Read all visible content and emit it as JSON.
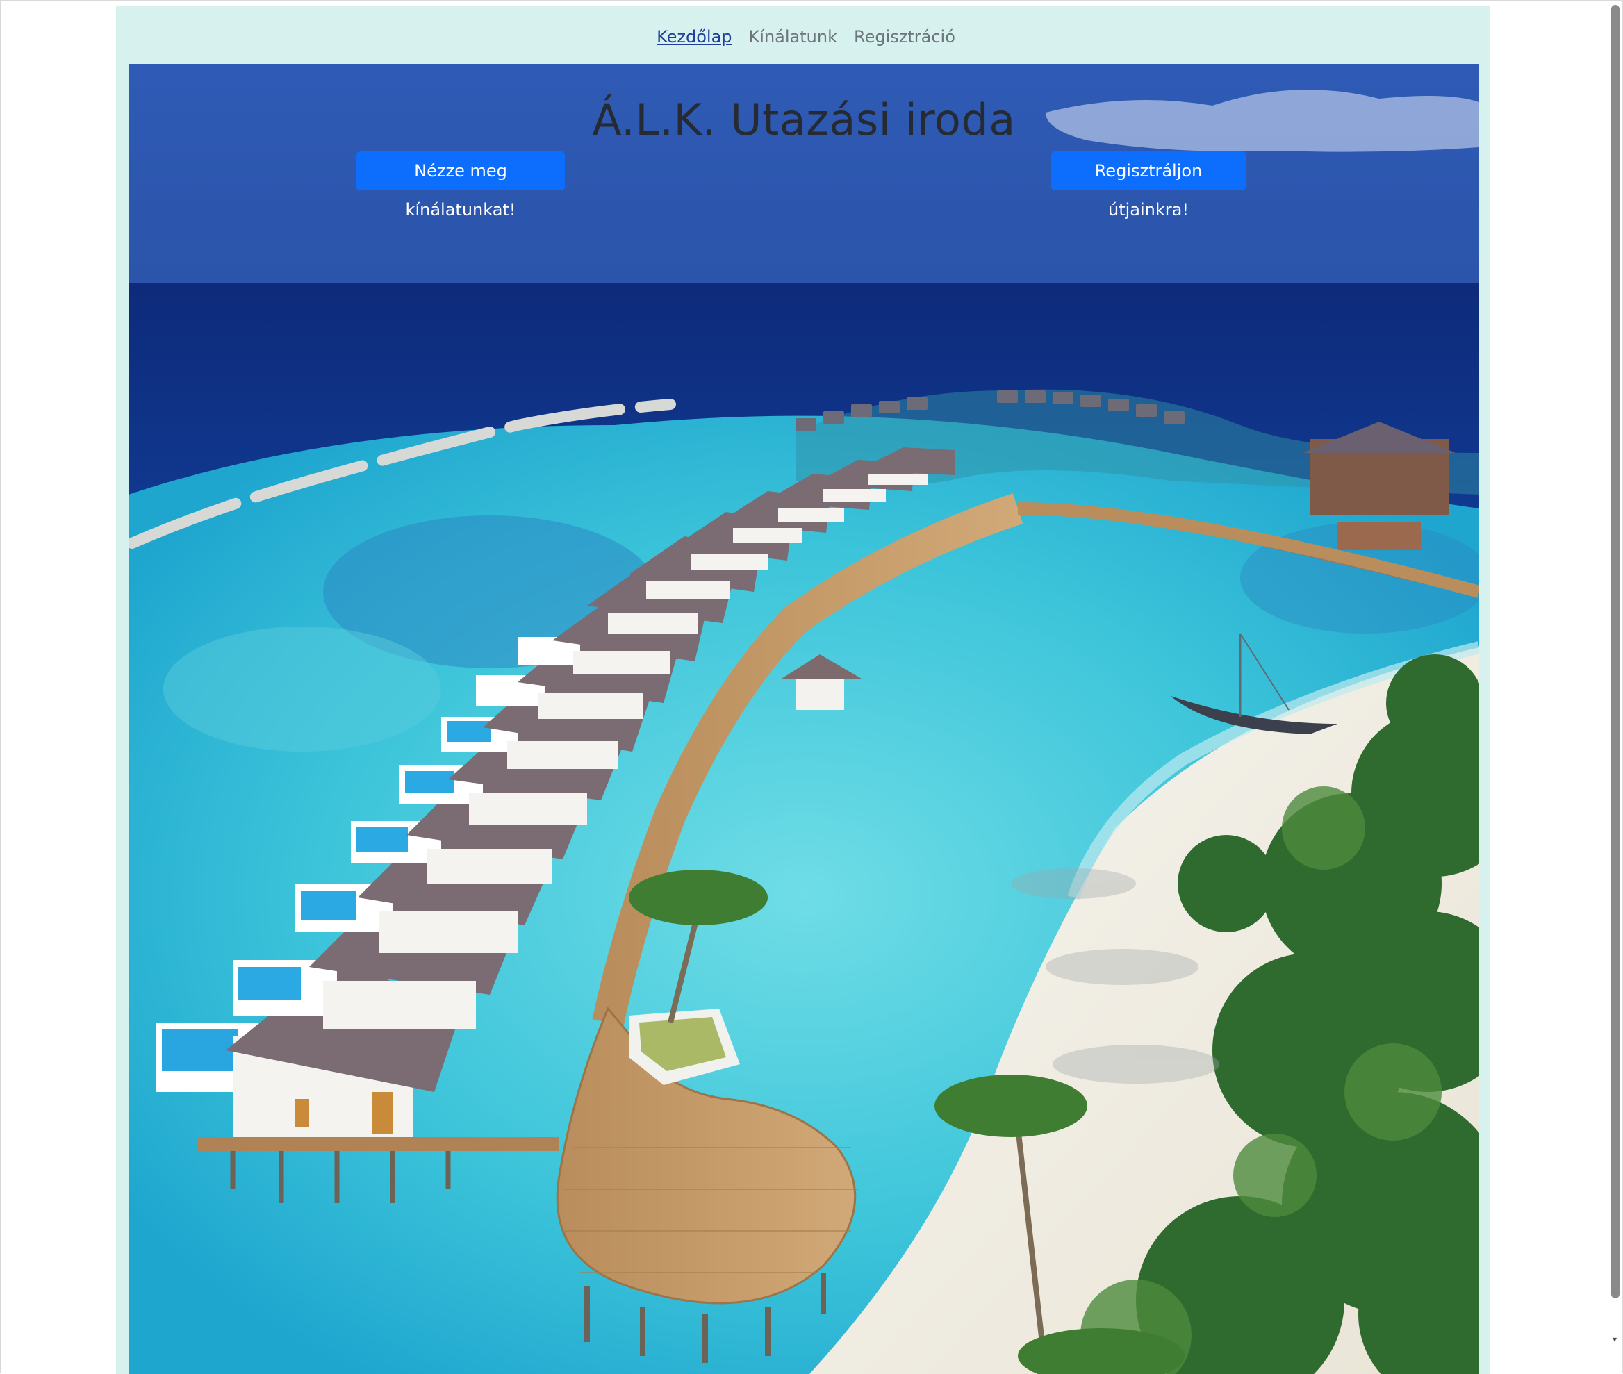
{
  "nav": {
    "items": [
      {
        "label": "Kezdőlap",
        "active": true
      },
      {
        "label": "Kínálatunk",
        "active": false
      },
      {
        "label": "Regisztráció",
        "active": false
      }
    ]
  },
  "hero": {
    "title": "Á.L.K. Utazási iroda",
    "buttons": {
      "offers": "Nézze meg kínálatunkat!",
      "register": "Regisztráljon útjainkra!"
    },
    "image_description_icon": "tropical-resort-photo"
  },
  "colors": {
    "page_background": "#d7f1ee",
    "button_primary": "#0d6efd",
    "nav_active": "#1f3f9a",
    "nav_inactive": "#6c757d"
  },
  "icons": {
    "scroll_down": "chevron-down-icon"
  }
}
